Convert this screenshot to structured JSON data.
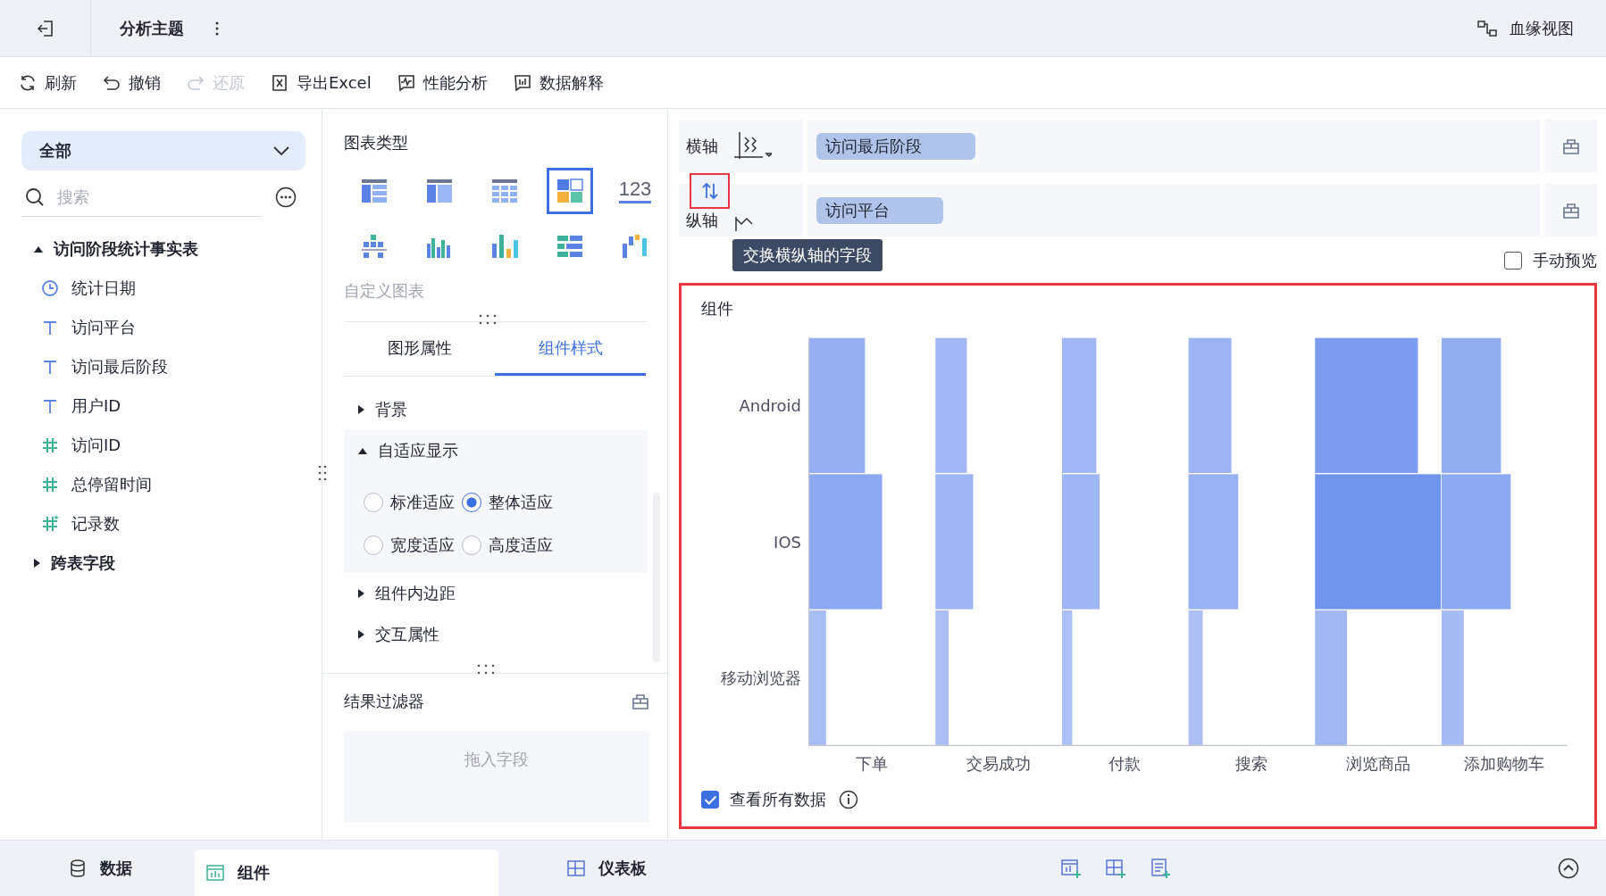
{
  "topbar": {
    "title": "分析主题",
    "lineage": "血缘视图"
  },
  "toolbar": [
    {
      "label": "刷新",
      "kind": "refresh",
      "disabled": false
    },
    {
      "label": "撤销",
      "kind": "undo",
      "disabled": false
    },
    {
      "label": "还原",
      "kind": "redo",
      "disabled": true
    },
    {
      "label": "导出Excel",
      "kind": "excel",
      "disabled": false
    },
    {
      "label": "性能分析",
      "kind": "performance",
      "disabled": false
    },
    {
      "label": "数据解释",
      "kind": "explain",
      "disabled": false
    }
  ],
  "sidebar": {
    "dropdown": "全部",
    "search": {
      "placeholder": "搜索"
    },
    "tree": [
      {
        "label": "访问阶段统计事实表",
        "expanded": true,
        "children": [
          {
            "label": "统计日期",
            "kind": "date"
          },
          {
            "label": "访问平台",
            "kind": "text"
          },
          {
            "label": "访问最后阶段",
            "kind": "text"
          },
          {
            "label": "用户ID",
            "kind": "text"
          },
          {
            "label": "访问ID",
            "kind": "number"
          },
          {
            "label": "总停留时间",
            "kind": "number"
          },
          {
            "label": "记录数",
            "kind": "count"
          }
        ]
      },
      {
        "label": "跨表字段",
        "expanded": false
      }
    ]
  },
  "chart_types": {
    "title": "图表类型",
    "items": [
      {
        "kind": "table",
        "selected": false
      },
      {
        "kind": "cross-table",
        "selected": false
      },
      {
        "kind": "detail-table",
        "selected": false
      },
      {
        "kind": "block",
        "selected": true
      },
      {
        "kind": "number",
        "label": "123",
        "selected": false
      },
      {
        "kind": "dot-bar",
        "selected": false
      },
      {
        "kind": "grouped-bar",
        "selected": false
      },
      {
        "kind": "color-bar",
        "selected": false
      },
      {
        "kind": "horizontal-bar",
        "selected": false
      },
      {
        "kind": "waterfall",
        "selected": false
      }
    ],
    "custom": "自定义图表"
  },
  "tabs": [
    {
      "label": "图形属性",
      "selected": false
    },
    {
      "label": "组件样式",
      "selected": true
    }
  ],
  "sections": [
    {
      "label": "背景",
      "expanded": false
    },
    {
      "label": "自适应显示",
      "expanded": true,
      "options": [
        {
          "label": "标准适应",
          "selected": false
        },
        {
          "label": "整体适应",
          "selected": true
        },
        {
          "label": "宽度适应",
          "selected": false
        },
        {
          "label": "高度适应",
          "selected": false
        }
      ]
    },
    {
      "label": "组件内边距",
      "expanded": false
    },
    {
      "label": "交互属性",
      "expanded": false
    }
  ],
  "filter": {
    "title": "结果过滤器",
    "placeholder": "拖入字段"
  },
  "axes": [
    {
      "label": "横轴",
      "field": "访问最后阶段"
    },
    {
      "label": "纵轴",
      "field": "访问平台"
    }
  ],
  "swap_tooltip": "交换横纵轴的字段",
  "manual_preview": {
    "label": "手动预览",
    "checked": false
  },
  "widget": {
    "title": "组件",
    "y_labels": [
      "Android",
      "IOS",
      "移动浏览器"
    ],
    "x_labels": [
      "下单",
      "交易成功",
      "付款",
      "搜索",
      "浏览商品",
      "添加购物车"
    ],
    "view_all": {
      "label": "查看所有数据",
      "checked": true
    }
  },
  "bottom_tabs": [
    {
      "label": "数据",
      "kind": "data",
      "selected": false
    },
    {
      "label": "组件",
      "kind": "widget",
      "selected": true
    },
    {
      "label": "仪表板",
      "kind": "dashboard",
      "selected": false
    }
  ]
}
